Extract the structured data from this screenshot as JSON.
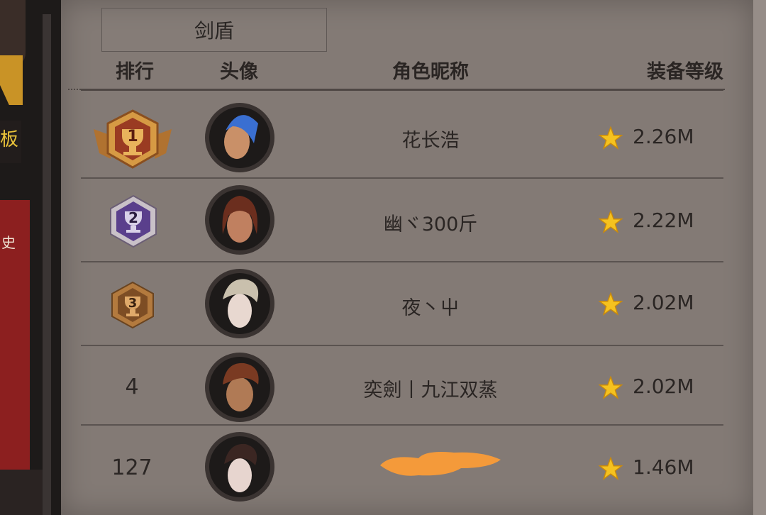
{
  "sidebar": {
    "partial_text_1": "板",
    "partial_text_2": "史"
  },
  "tab": {
    "label": "剑盾"
  },
  "headers": {
    "rank": "排行",
    "avatar": "头像",
    "name": "角色昵称",
    "level": "装备等级"
  },
  "rows": [
    {
      "rank": "1",
      "name": "花长浩",
      "level": "2.26M",
      "badge": "gold",
      "avatar_hair": "#3a6fd1",
      "avatar_skin": "#c99068"
    },
    {
      "rank": "2",
      "name": "幽ヾ300斤",
      "level": "2.22M",
      "badge": "purple",
      "avatar_hair": "#6b2e1e",
      "avatar_skin": "#c08060"
    },
    {
      "rank": "3",
      "name": "夜丶屮",
      "level": "2.02M",
      "badge": "bronze",
      "avatar_hair": "#c9c0ad",
      "avatar_skin": "#e8d8d0"
    },
    {
      "rank": "4",
      "name": "奕劍丨九江双蒸",
      "level": "2.02M",
      "badge": "",
      "avatar_hair": "#7a3a22",
      "avatar_skin": "#b07a55"
    },
    {
      "rank": "127",
      "name": "",
      "level": "1.46M",
      "badge": "",
      "avatar_hair": "#3b2622",
      "avatar_skin": "#e7d5cf"
    }
  ],
  "colors": {
    "panel": "#837a75",
    "star": "#f5c21f",
    "redaction": "#f49a3a"
  },
  "icons": {
    "star": "star-icon",
    "gold_badge": "rank-1-trophy-icon",
    "purple_badge": "rank-2-trophy-icon",
    "bronze_badge": "rank-3-trophy-icon"
  }
}
